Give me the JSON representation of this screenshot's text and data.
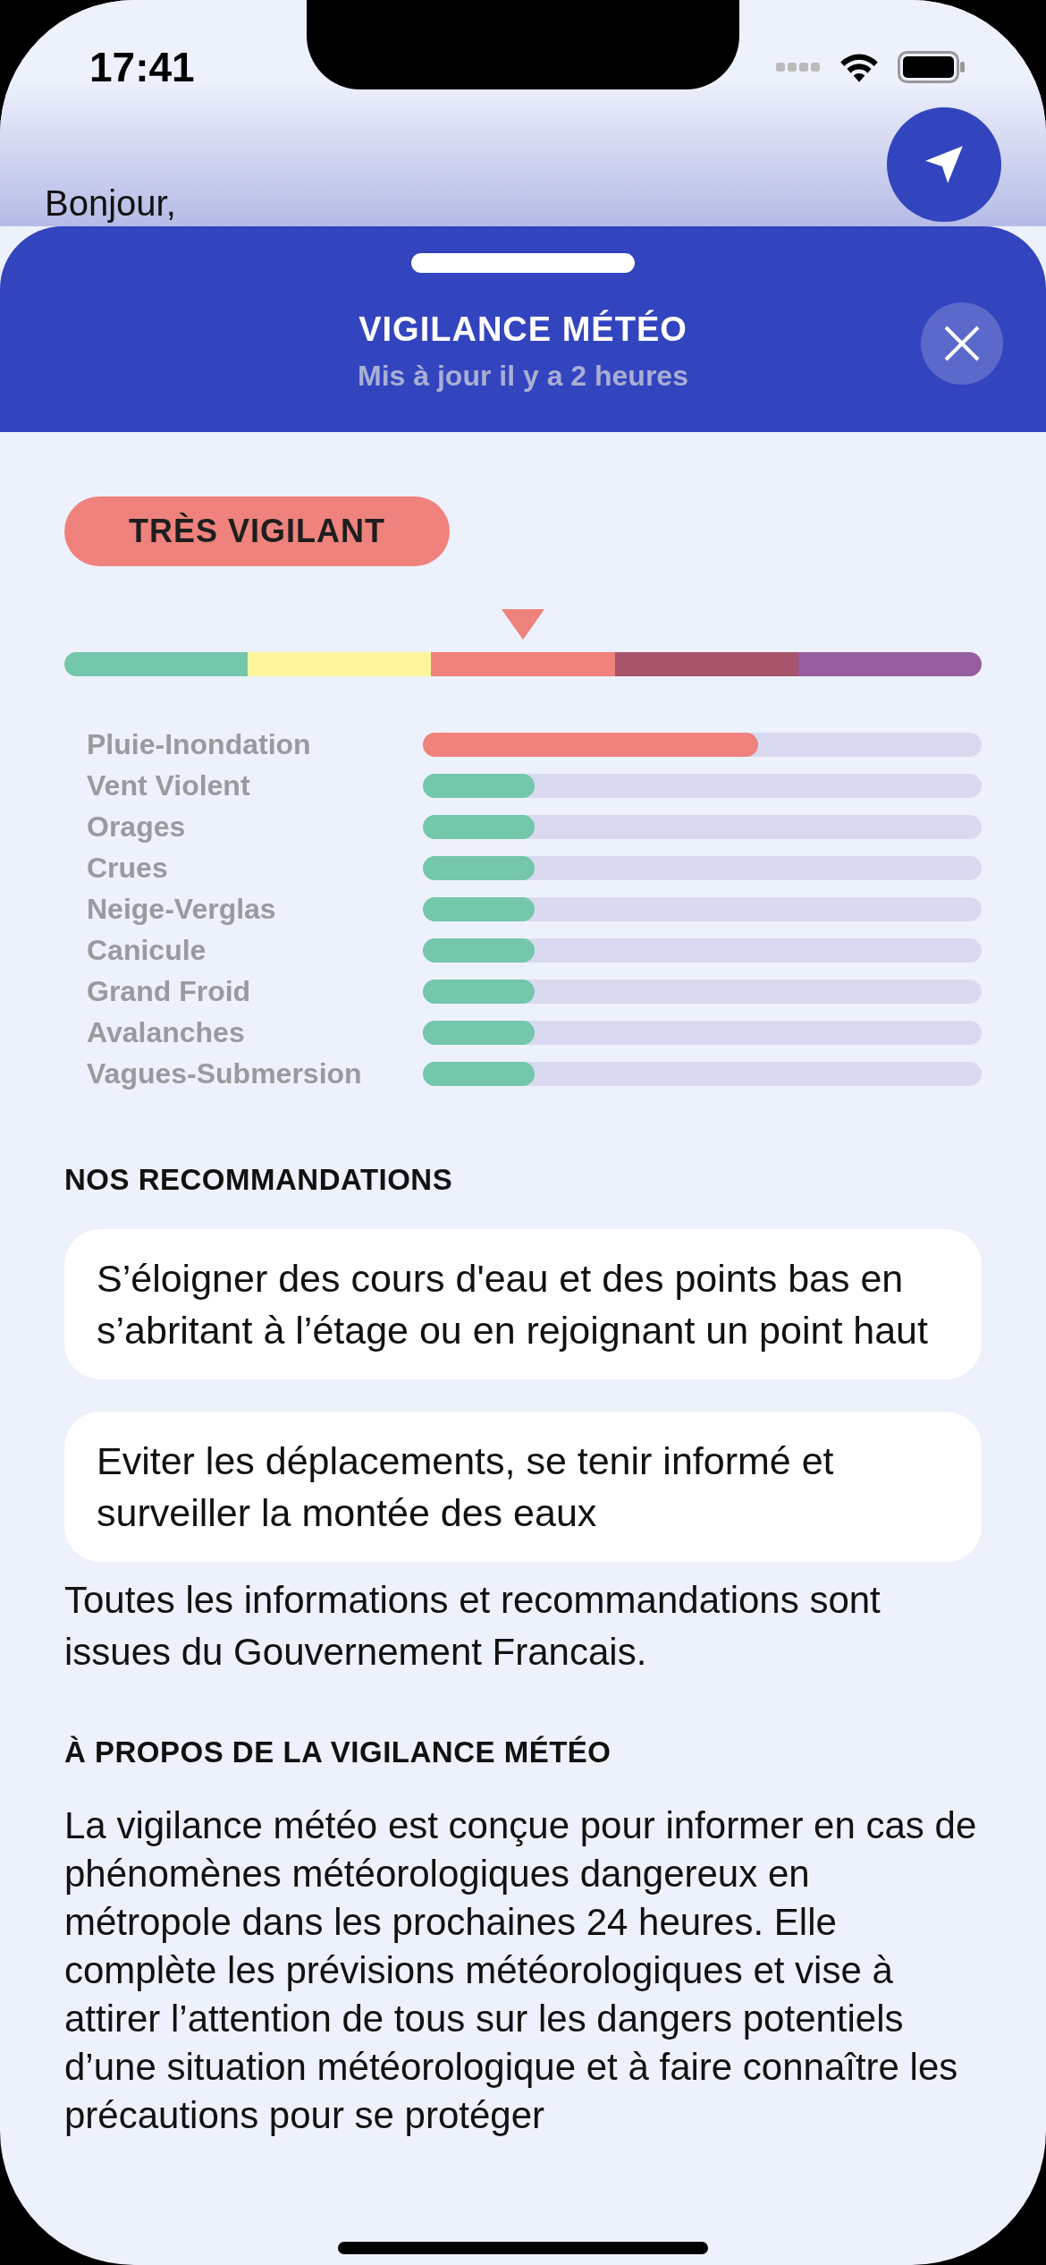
{
  "status_bar": {
    "time": "17:41"
  },
  "background": {
    "greeting": "Bonjour,"
  },
  "sheet": {
    "title": "VIGILANCE MÉTÉO",
    "subtitle": "Mis à jour il y a 2 heures"
  },
  "level_badge": {
    "label": "TRÈS VIGILANT",
    "color": "#ef827c"
  },
  "scale": [
    {
      "color": "#74c7ab",
      "selected": false
    },
    {
      "color": "#fdf59b",
      "selected": false
    },
    {
      "color": "#ef827c",
      "selected": true
    },
    {
      "color": "#a6546a",
      "selected": false
    },
    {
      "color": "#965ea0",
      "selected": false
    }
  ],
  "risks": [
    {
      "name": "Pluie-Inondation",
      "level": 0.6,
      "color": "#ef827c"
    },
    {
      "name": "Vent Violent",
      "level": 0.2,
      "color": "#74c7ab"
    },
    {
      "name": "Orages",
      "level": 0.2,
      "color": "#74c7ab"
    },
    {
      "name": "Crues",
      "level": 0.2,
      "color": "#74c7ab"
    },
    {
      "name": "Neige-Verglas",
      "level": 0.2,
      "color": "#74c7ab"
    },
    {
      "name": "Canicule",
      "level": 0.2,
      "color": "#74c7ab"
    },
    {
      "name": "Grand Froid",
      "level": 0.2,
      "color": "#74c7ab"
    },
    {
      "name": "Avalanches",
      "level": 0.2,
      "color": "#74c7ab"
    },
    {
      "name": "Vagues-Submersion",
      "level": 0.2,
      "color": "#74c7ab"
    }
  ],
  "recommendations": {
    "title": "NOS RECOMMANDATIONS",
    "items": [
      "S’éloigner des cours d'eau et des points bas en s’abritant à l’étage ou en rejoignant un point haut",
      "Eviter les déplacements, se tenir informé et surveiller la montée des eaux"
    ],
    "source": "Toutes les informations et recommandations sont issues du Gouvernement Francais."
  },
  "about": {
    "title": "À PROPOS DE LA VIGILANCE MÉTÉO",
    "text": "La vigilance météo est conçue pour informer en cas de phénomènes météorologiques dangereux en métropole dans les prochaines 24 heures. Elle complète les prévisions météorologiques et vise à attirer l’attention de tous sur les dangers potentiels d’une situation météorologique et à faire connaître les précautions pour se protéger"
  }
}
